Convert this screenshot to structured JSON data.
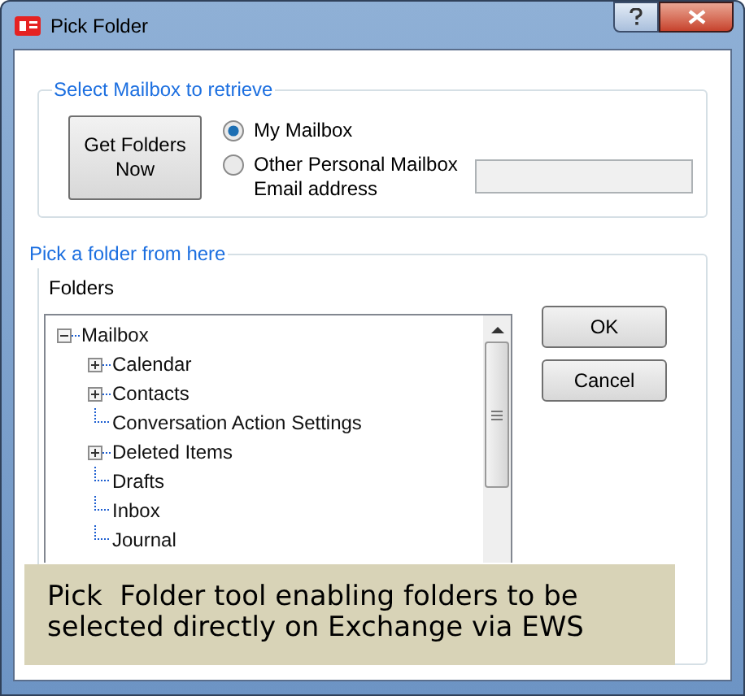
{
  "window": {
    "title": "Pick Folder"
  },
  "mailbox_group": {
    "title": "Select Mailbox to retrieve",
    "get_button": "Get Folders Now",
    "options": [
      {
        "label": "My Mailbox",
        "selected": true
      },
      {
        "label": "Other Personal Mailbox Email address",
        "selected": false
      }
    ],
    "email_field": {
      "disabled": true
    }
  },
  "folder_group": {
    "title": "Pick a folder from here",
    "tree_label": "Folders",
    "tree": [
      {
        "label": "Mailbox",
        "expanded": true,
        "children": [
          {
            "label": "Calendar",
            "expanded": false
          },
          {
            "label": "Contacts",
            "expanded": false
          },
          {
            "label": "Conversation Action Settings"
          },
          {
            "label": "Deleted Items",
            "expanded": false
          },
          {
            "label": "Drafts"
          },
          {
            "label": "Inbox"
          },
          {
            "label": "Journal"
          }
        ]
      }
    ],
    "buttons": [
      "OK",
      "Cancel"
    ]
  },
  "caption": "Pick  Folder tool enabling folders to be selected directly on Exchange via EWS"
}
